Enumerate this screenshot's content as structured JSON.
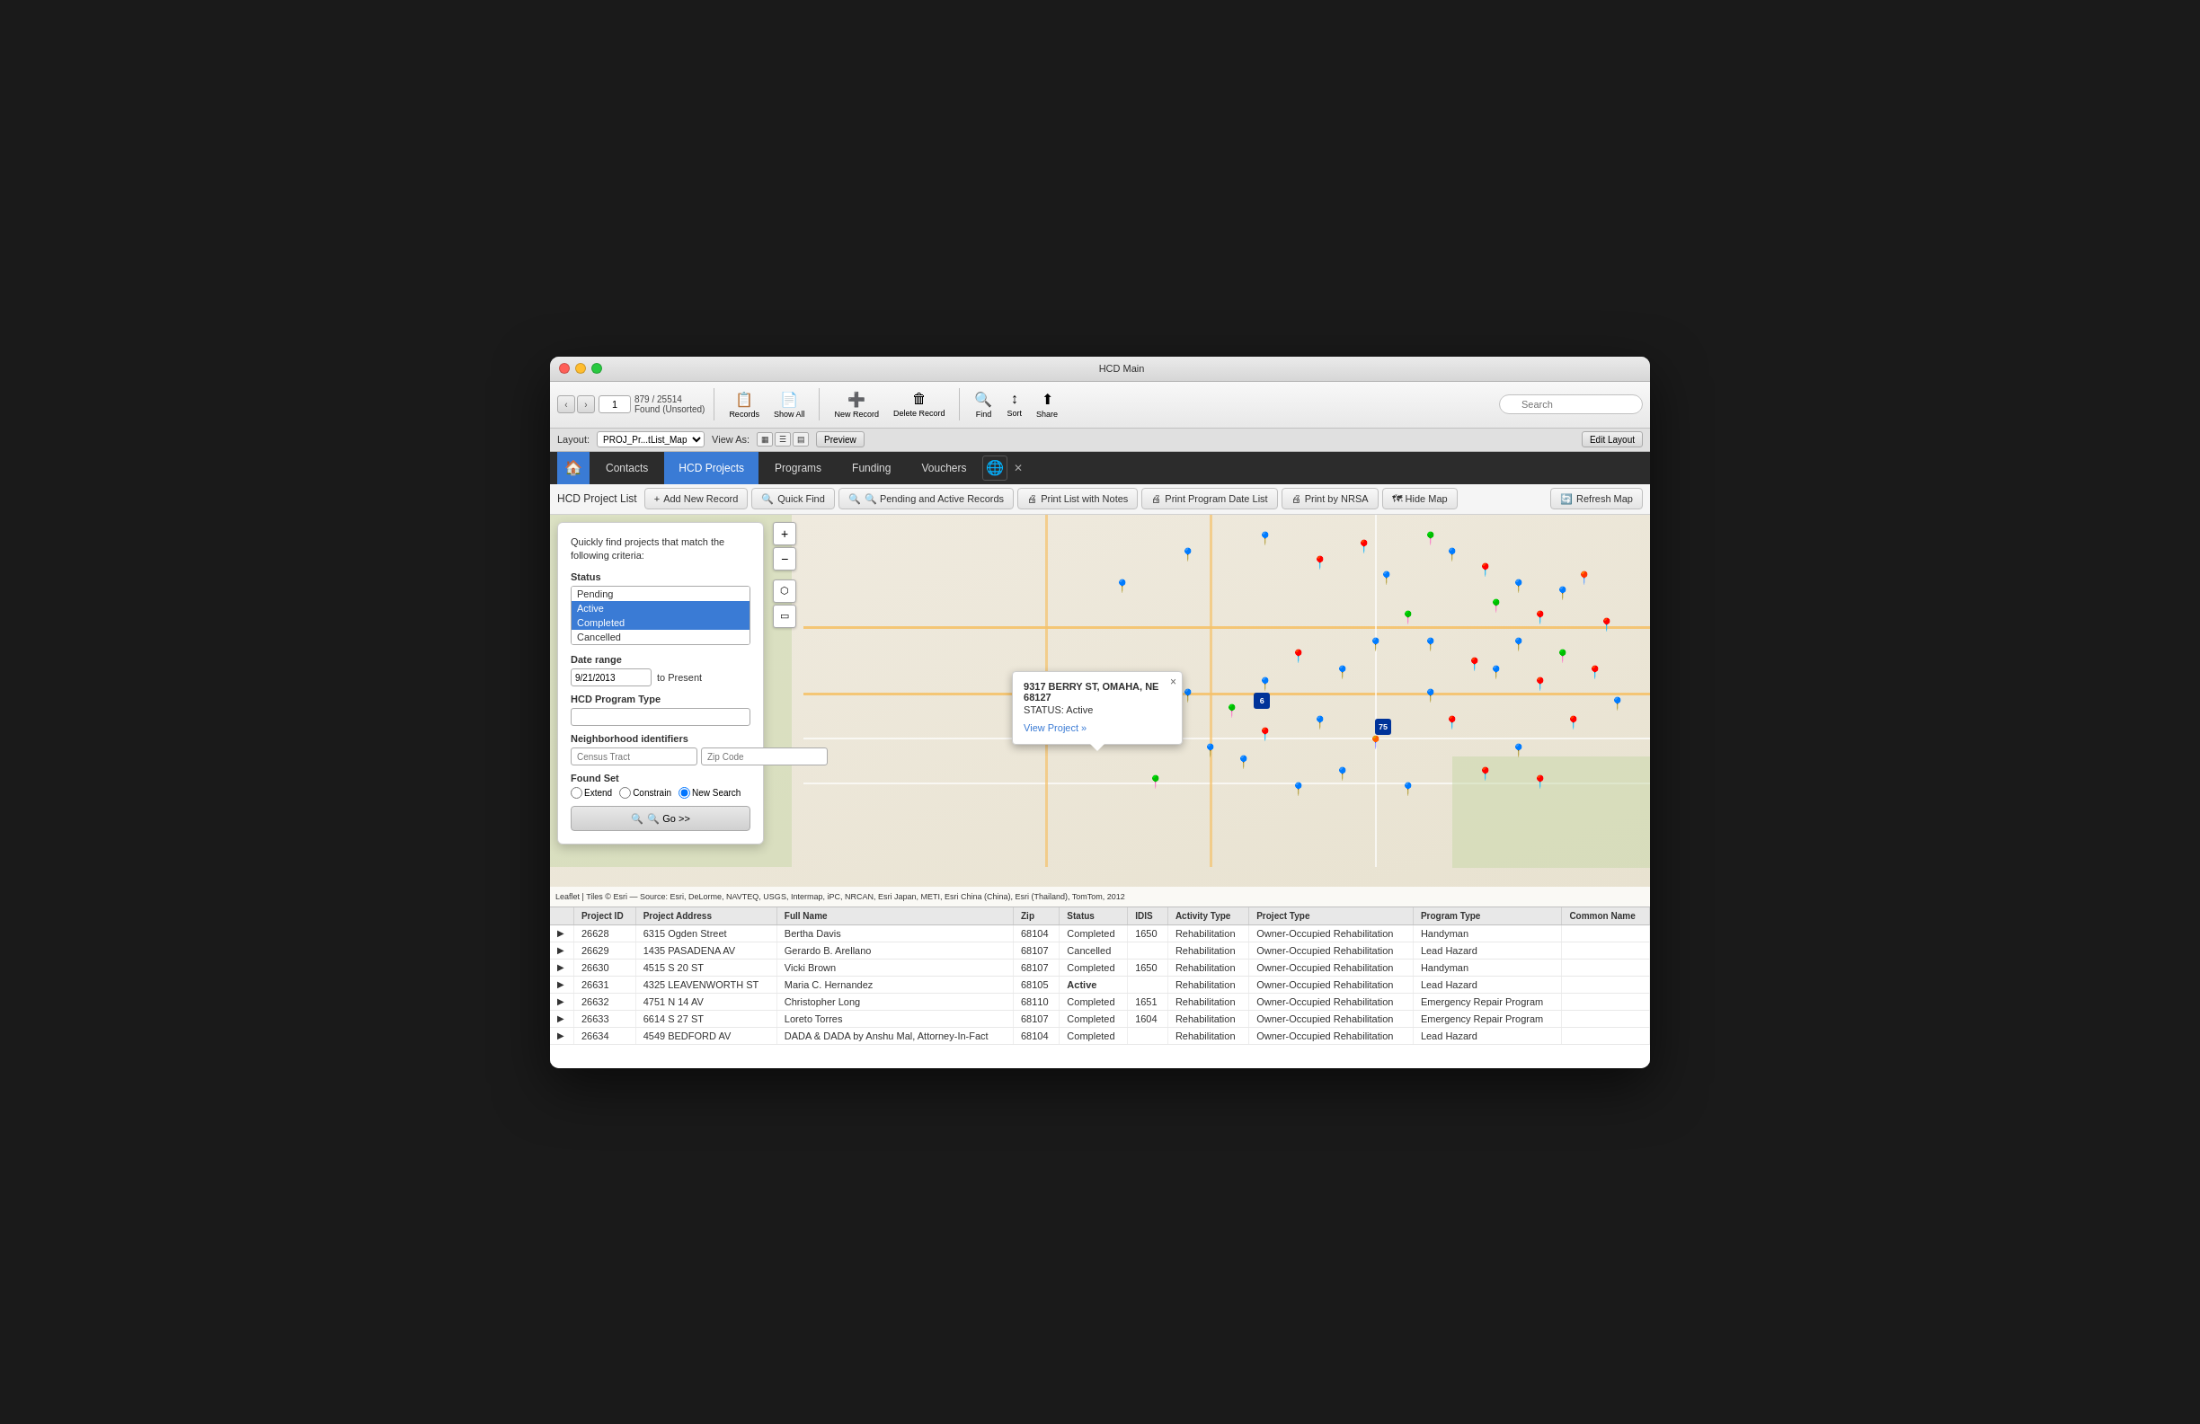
{
  "window": {
    "title": "HCD Main",
    "titlebar_buttons": [
      "close",
      "minimize",
      "maximize"
    ]
  },
  "toolbar": {
    "page_number": "1",
    "record_count": "879 / 25514",
    "record_count_label": "Found (Unsorted)",
    "records_label": "Records",
    "show_all_label": "Show All",
    "new_record_label": "New Record",
    "delete_record_label": "Delete Record",
    "find_label": "Find",
    "sort_label": "Sort",
    "share_label": "Share",
    "search_placeholder": "Search"
  },
  "layoutbar": {
    "layout_label": "Layout:",
    "layout_name": "PROJ_Pr...tList_Map",
    "view_as_label": "View As:",
    "preview_label": "Preview",
    "edit_layout_label": "Edit Layout"
  },
  "navbar": {
    "home_icon": "🏠",
    "tabs": [
      {
        "label": "Contacts",
        "active": false
      },
      {
        "label": "HCD Projects",
        "active": true
      },
      {
        "label": "Programs",
        "active": false
      },
      {
        "label": "Funding",
        "active": false
      },
      {
        "label": "Vouchers",
        "active": false
      }
    ]
  },
  "actionbar": {
    "title": "HCD Project List",
    "buttons": [
      {
        "label": "+ Add New Record",
        "icon": "+"
      },
      {
        "label": "🔍 Quick Find",
        "icon": "🔍"
      },
      {
        "label": "🔍 Pending and Active Records",
        "icon": "🔍"
      },
      {
        "label": "🖨 Print List with Notes",
        "icon": "🖨"
      },
      {
        "label": "🖨 Print Program Date List",
        "icon": "🖨"
      },
      {
        "label": "🖨 Print by NRSA",
        "icon": "🖨"
      },
      {
        "label": "🗺 Hide Map",
        "icon": "🗺"
      },
      {
        "label": "🔄 Refresh Map",
        "icon": "🔄"
      }
    ]
  },
  "quickfind": {
    "title": "Quickly find projects that match the following criteria:",
    "status_label": "Status",
    "status_options": [
      "Pending",
      "Active",
      "Completed",
      "Cancelled"
    ],
    "date_range_label": "Date range",
    "date_from": "9/21/2013",
    "date_to_label": "to Present",
    "program_type_label": "HCD Program Type",
    "program_type_value": "",
    "neighborhood_label": "Neighborhood identifiers",
    "census_tract_placeholder": "Census Tract",
    "zip_code_placeholder": "Zip Code",
    "found_set_label": "Found Set",
    "found_set_options": [
      "Extend",
      "Constrain",
      "New Search"
    ],
    "found_set_selected": "New Search",
    "go_label": "🔍 Go >>"
  },
  "map_popup": {
    "address": "9317 BERRY ST, OMAHA, NE 68127",
    "status": "STATUS: Active",
    "link_label": "View Project »",
    "close_label": "×"
  },
  "map_attribution": "Leaflet | Tiles © Esri — Source: Esri, DeLorme, NAVTEQ, USGS, Intermap, iPC, NRCAN, Esri Japan, METI, Esri China (China), Esri (Thailand), TomTom, 2012",
  "table": {
    "columns": [
      "",
      "Project ID",
      "Project Address",
      "Full Name",
      "Zip",
      "Status",
      "IDIS",
      "Activity Type",
      "Project Type",
      "Program Type",
      "Common Name"
    ],
    "rows": [
      {
        "arrow": "▶",
        "id": "26628",
        "address": "6315 Ogden Street",
        "name": "Bertha Davis",
        "zip": "68104",
        "status": "Completed",
        "status_class": "status-completed",
        "idis": "1650",
        "activity": "Rehabilitation",
        "project_type": "Owner-Occupied Rehabilitation",
        "program": "Handyman",
        "common": ""
      },
      {
        "arrow": "▶",
        "id": "26629",
        "address": "1435 PASADENA AV",
        "name": "Gerardo B. Arellano",
        "zip": "68107",
        "status": "Cancelled",
        "status_class": "status-cancelled",
        "idis": "",
        "activity": "Rehabilitation",
        "project_type": "Owner-Occupied Rehabilitation",
        "program": "Lead Hazard",
        "common": ""
      },
      {
        "arrow": "▶",
        "id": "26630",
        "address": "4515 S 20 ST",
        "name": "Vicki Brown",
        "zip": "68107",
        "status": "Completed",
        "status_class": "status-completed",
        "idis": "1650",
        "activity": "Rehabilitation",
        "project_type": "Owner-Occupied Rehabilitation",
        "program": "Handyman",
        "common": ""
      },
      {
        "arrow": "▶",
        "id": "26631",
        "address": "4325 LEAVENWORTH ST",
        "name": "Maria  C. Hernandez",
        "zip": "68105",
        "status": "Active",
        "status_class": "status-active",
        "idis": "",
        "activity": "Rehabilitation",
        "project_type": "Owner-Occupied Rehabilitation",
        "program": "Lead Hazard",
        "common": ""
      },
      {
        "arrow": "▶",
        "id": "26632",
        "address": "4751 N 14 AV",
        "name": "Christopher Long",
        "zip": "68110",
        "status": "Completed",
        "status_class": "status-completed",
        "idis": "1651",
        "activity": "Rehabilitation",
        "project_type": "Owner-Occupied Rehabilitation",
        "program": "Emergency Repair Program",
        "common": ""
      },
      {
        "arrow": "▶",
        "id": "26633",
        "address": "6614 S 27 ST",
        "name": "Loreto Torres",
        "zip": "68107",
        "status": "Completed",
        "status_class": "status-completed",
        "idis": "1604",
        "activity": "Rehabilitation",
        "project_type": "Owner-Occupied Rehabilitation",
        "program": "Emergency Repair Program",
        "common": ""
      },
      {
        "arrow": "▶",
        "id": "26634",
        "address": "4549 BEDFORD AV",
        "name": "DADA & DADA by Anshu Mal, Attorney-In-Fact",
        "zip": "68104",
        "status": "Completed",
        "status_class": "status-completed",
        "idis": "",
        "activity": "Rehabilitation",
        "project_type": "Owner-Occupied Rehabilitation",
        "program": "Lead Hazard",
        "common": ""
      }
    ]
  },
  "markers": [
    {
      "x": 52,
      "y": 20,
      "color": "blue"
    },
    {
      "x": 58,
      "y": 12,
      "color": "blue"
    },
    {
      "x": 65,
      "y": 8,
      "color": "blue"
    },
    {
      "x": 70,
      "y": 14,
      "color": "red"
    },
    {
      "x": 74,
      "y": 10,
      "color": "red"
    },
    {
      "x": 76,
      "y": 18,
      "color": "blue"
    },
    {
      "x": 80,
      "y": 8,
      "color": "green"
    },
    {
      "x": 82,
      "y": 12,
      "color": "blue"
    },
    {
      "x": 85,
      "y": 16,
      "color": "red"
    },
    {
      "x": 88,
      "y": 20,
      "color": "blue"
    },
    {
      "x": 86,
      "y": 25,
      "color": "green"
    },
    {
      "x": 90,
      "y": 28,
      "color": "red"
    },
    {
      "x": 92,
      "y": 22,
      "color": "blue"
    },
    {
      "x": 94,
      "y": 18,
      "color": "orange"
    },
    {
      "x": 96,
      "y": 30,
      "color": "red"
    },
    {
      "x": 88,
      "y": 35,
      "color": "blue"
    },
    {
      "x": 84,
      "y": 40,
      "color": "red"
    },
    {
      "x": 80,
      "y": 35,
      "color": "blue"
    },
    {
      "x": 78,
      "y": 28,
      "color": "green"
    },
    {
      "x": 75,
      "y": 35,
      "color": "blue"
    },
    {
      "x": 72,
      "y": 42,
      "color": "blue"
    },
    {
      "x": 68,
      "y": 38,
      "color": "red"
    },
    {
      "x": 65,
      "y": 45,
      "color": "blue"
    },
    {
      "x": 62,
      "y": 52,
      "color": "green"
    },
    {
      "x": 58,
      "y": 48,
      "color": "blue"
    },
    {
      "x": 55,
      "y": 55,
      "color": "blue"
    },
    {
      "x": 60,
      "y": 62,
      "color": "blue"
    },
    {
      "x": 65,
      "y": 58,
      "color": "red"
    },
    {
      "x": 70,
      "y": 55,
      "color": "blue"
    },
    {
      "x": 75,
      "y": 60,
      "color": "yellow"
    },
    {
      "x": 80,
      "y": 48,
      "color": "blue"
    },
    {
      "x": 82,
      "y": 55,
      "color": "red"
    },
    {
      "x": 86,
      "y": 42,
      "color": "blue"
    },
    {
      "x": 90,
      "y": 45,
      "color": "red"
    },
    {
      "x": 92,
      "y": 38,
      "color": "green"
    },
    {
      "x": 95,
      "y": 42,
      "color": "red"
    },
    {
      "x": 97,
      "y": 50,
      "color": "blue"
    },
    {
      "x": 93,
      "y": 55,
      "color": "red"
    },
    {
      "x": 88,
      "y": 62,
      "color": "blue"
    },
    {
      "x": 85,
      "y": 68,
      "color": "red"
    },
    {
      "x": 90,
      "y": 70,
      "color": "red"
    },
    {
      "x": 78,
      "y": 72,
      "color": "blue"
    },
    {
      "x": 72,
      "y": 68,
      "color": "blue"
    },
    {
      "x": 68,
      "y": 72,
      "color": "blue"
    },
    {
      "x": 63,
      "y": 65,
      "color": "blue"
    },
    {
      "x": 55,
      "y": 70,
      "color": "green"
    }
  ]
}
